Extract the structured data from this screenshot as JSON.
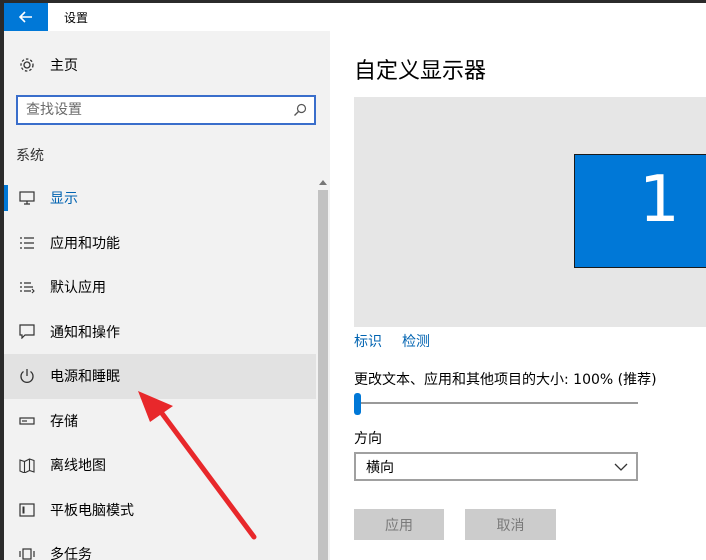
{
  "window": {
    "title": "设置",
    "back_icon": "back-arrow-icon",
    "accent_color": "#0078d7"
  },
  "sidebar": {
    "home": {
      "label": "主页",
      "icon": "gear-icon"
    },
    "search": {
      "placeholder": "查找设置",
      "value": "",
      "icon": "search-icon"
    },
    "section_title": "系统",
    "items": [
      {
        "label": "显示",
        "icon": "display-icon",
        "state": "selected"
      },
      {
        "label": "应用和功能",
        "icon": "apps-list-icon"
      },
      {
        "label": "默认应用",
        "icon": "default-apps-icon"
      },
      {
        "label": "通知和操作",
        "icon": "notification-icon"
      },
      {
        "label": "电源和睡眠",
        "icon": "power-icon",
        "state": "hovered"
      },
      {
        "label": "存储",
        "icon": "storage-icon"
      },
      {
        "label": "离线地图",
        "icon": "map-icon"
      },
      {
        "label": "平板电脑模式",
        "icon": "tablet-icon"
      },
      {
        "label": "多任务",
        "icon": "multitask-icon"
      }
    ]
  },
  "content": {
    "title": "自定义显示器",
    "monitor_number": "1",
    "links": {
      "identify": "标识",
      "detect": "检测"
    },
    "scale": {
      "label": "更改文本、应用和其他项目的大小: 100% (推荐)",
      "value_percent": 0
    },
    "orientation": {
      "label": "方向",
      "selected": "横向"
    },
    "buttons": {
      "apply": "应用",
      "cancel": "取消"
    }
  },
  "annotation": {
    "arrow_color": "#e8282b",
    "points_to": "电源和睡眠"
  }
}
